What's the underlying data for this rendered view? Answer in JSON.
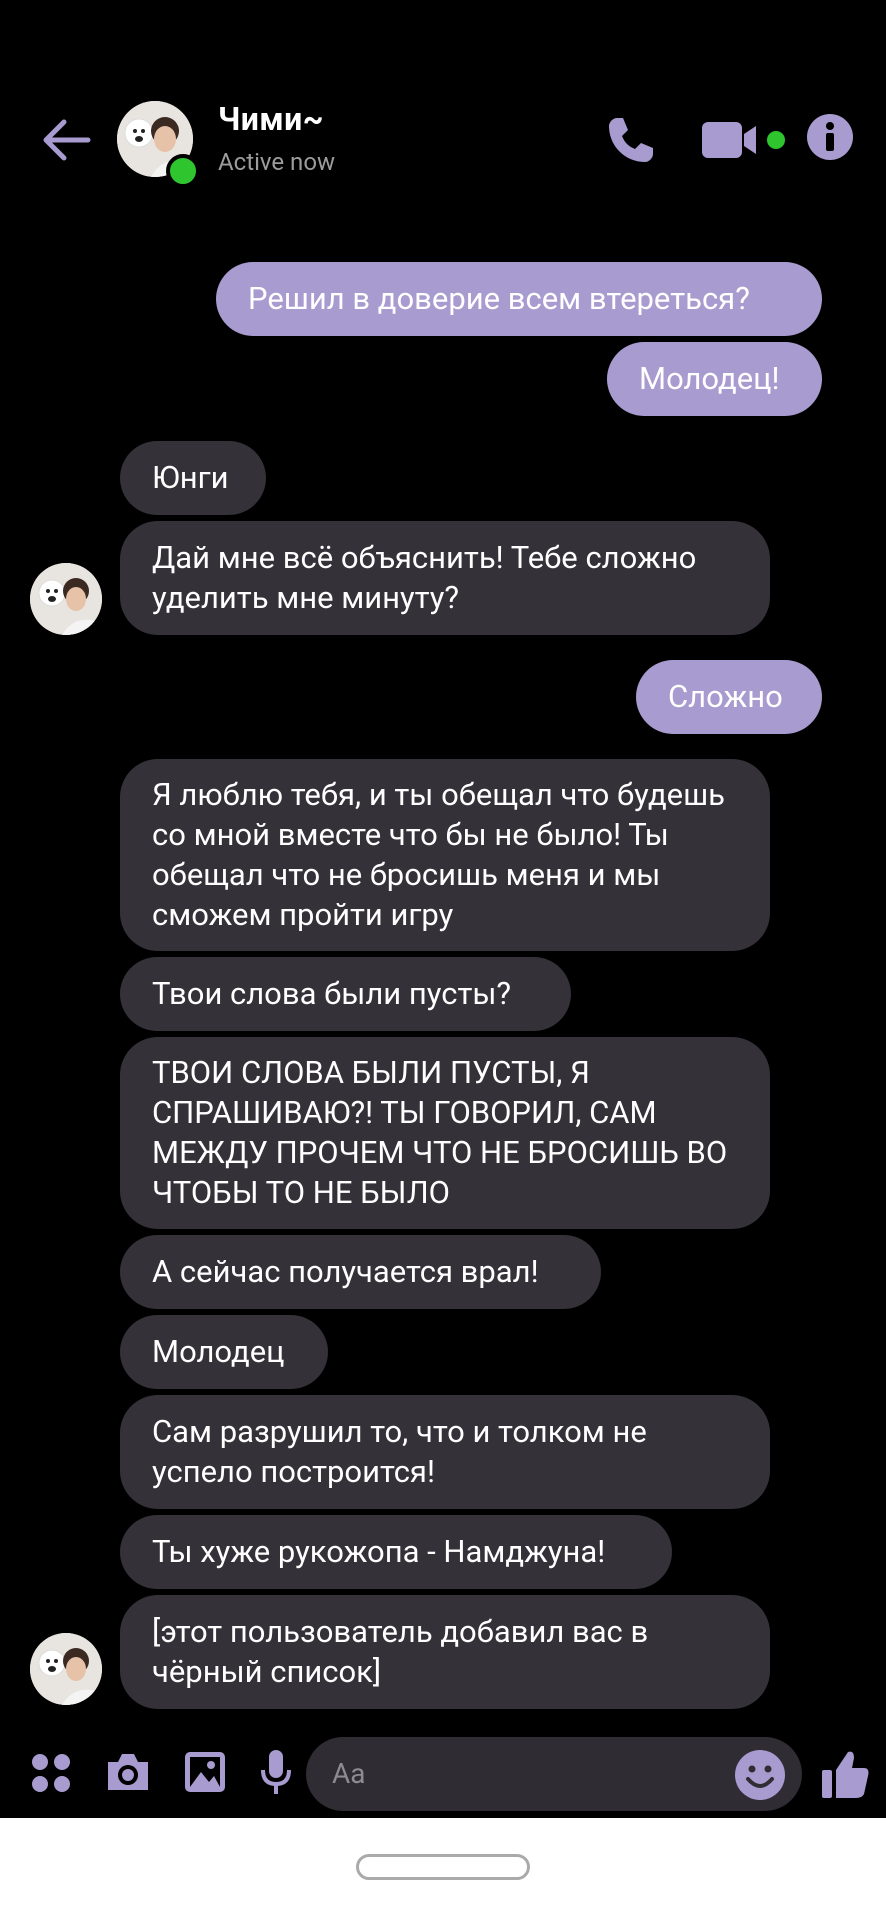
{
  "header": {
    "contact_name": "Чими~",
    "status": "Active now",
    "icons": [
      "back-arrow-icon",
      "phone-icon",
      "video-camera-icon",
      "info-icon"
    ]
  },
  "messages": [
    {
      "dir": "out",
      "text": "Решил в доверие всем втереться?"
    },
    {
      "dir": "out",
      "text": "Молодец!"
    },
    {
      "dir": "in",
      "text": "Юнги"
    },
    {
      "dir": "in",
      "text": "Дай мне всё объяснить! Тебе сложно уделить мне минуту?"
    },
    {
      "dir": "out",
      "text": "Сложно"
    },
    {
      "dir": "in",
      "text": "Я люблю тебя, и ты обещал что будешь со мной вместе что бы не было! Ты обещал что не бросишь меня и мы сможем пройти игру"
    },
    {
      "dir": "in",
      "text": "Твои слова были пусты?"
    },
    {
      "dir": "in",
      "text": "ТВОИ СЛОВА БЫЛИ ПУСТЫ, Я СПРАШИВАЮ?! ТЫ ГОВОРИЛ, САМ МЕЖДУ ПРОЧЕМ ЧТО НЕ БРОСИШЬ ВО ЧТОБЫ ТО НЕ БЫЛО"
    },
    {
      "dir": "in",
      "text": "А сейчас получается врал!"
    },
    {
      "dir": "in",
      "text": "Молодец"
    },
    {
      "dir": "in",
      "text": "Сам разрушил то, что и толком не успело построится!"
    },
    {
      "dir": "in",
      "text": "Ты хуже рукожопа - Намджуна!"
    },
    {
      "dir": "in",
      "text": "[этот пользователь добавил вас в чёрный список]"
    }
  ],
  "composer": {
    "placeholder": "Aa",
    "icons": [
      "apps-grid-icon",
      "camera-icon",
      "gallery-icon",
      "microphone-icon",
      "emoji-icon",
      "thumbs-up-icon"
    ]
  },
  "colors": {
    "accent": "#a89bcf",
    "incoming_bubble": "#343139",
    "online": "#2fc52f",
    "background": "#000000"
  }
}
